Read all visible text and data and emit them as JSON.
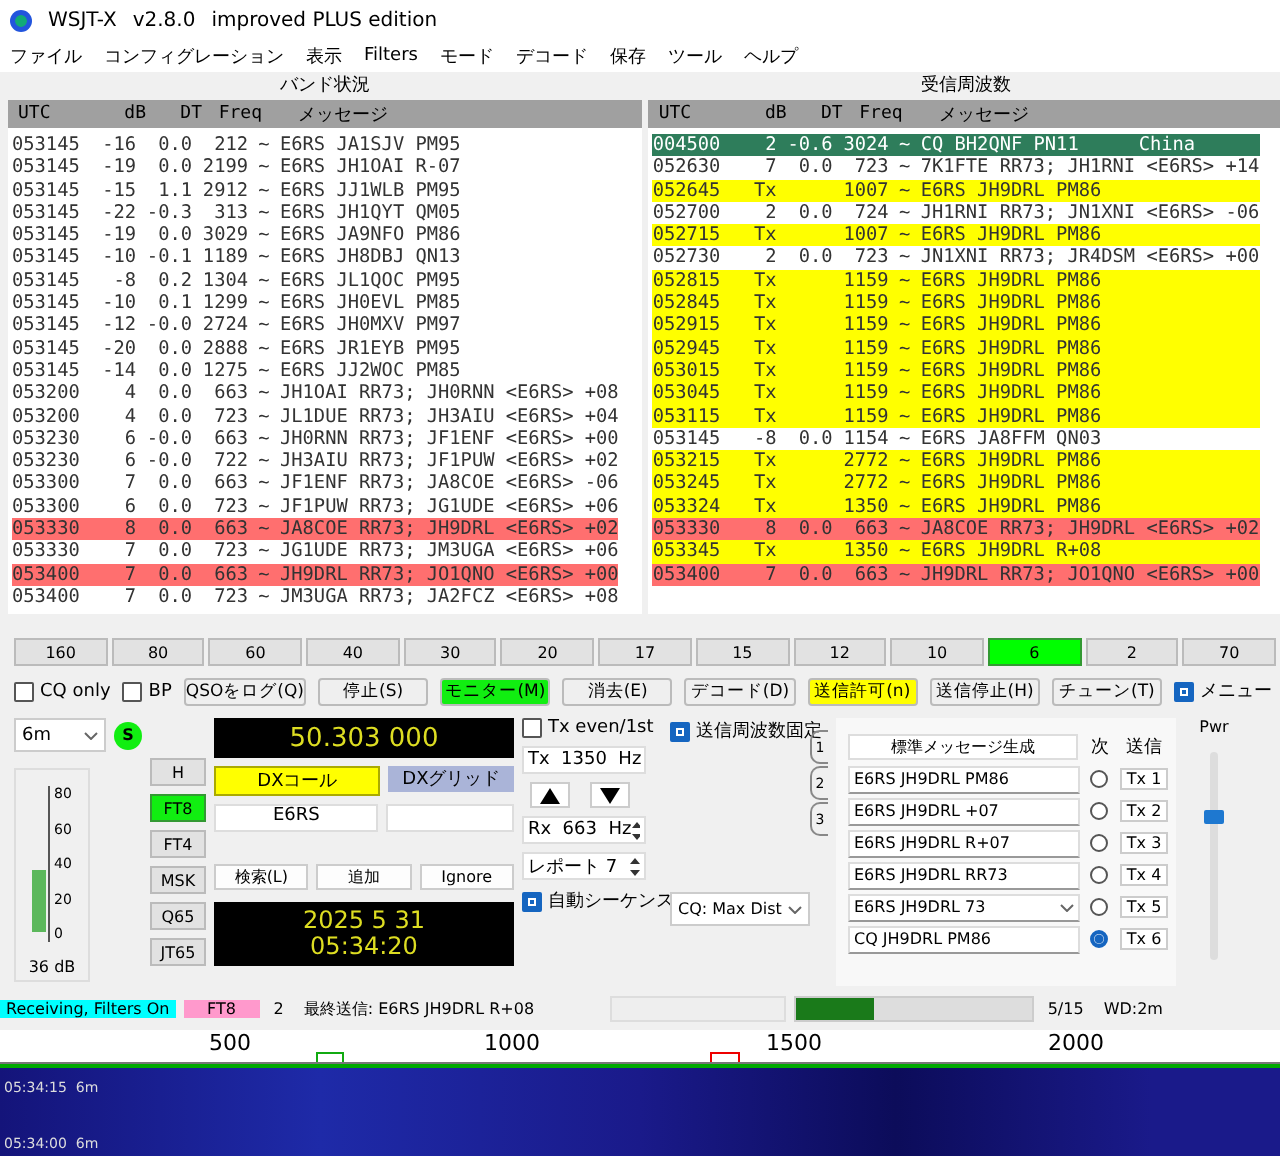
{
  "window": {
    "title": "WSJT-X",
    "version": "v2.8.0",
    "edition": "improved PLUS edition"
  },
  "menu": [
    "ファイル",
    "コンフィグレーション",
    "表示",
    "Filters",
    "モード",
    "デコード",
    "保存",
    "ツール",
    "ヘルプ"
  ],
  "band_activity": {
    "title": "バンド状況",
    "columns": [
      "UTC",
      "dB",
      "DT",
      "Freq",
      "メッセージ"
    ],
    "rows": [
      {
        "kind": "normal",
        "utc": "053145",
        "db": "-16",
        "dt": "0.0",
        "freq": "212",
        "sep": "~",
        "message": "E6RS JA1SJV PM95"
      },
      {
        "kind": "normal",
        "utc": "053145",
        "db": "-19",
        "dt": "0.0",
        "freq": "2199",
        "sep": "~",
        "message": "E6RS JH1OAI R-07"
      },
      {
        "kind": "normal",
        "utc": "053145",
        "db": "-15",
        "dt": "1.1",
        "freq": "2912",
        "sep": "~",
        "message": "E6RS JJ1WLB PM95"
      },
      {
        "kind": "normal",
        "utc": "053145",
        "db": "-22",
        "dt": "-0.3",
        "freq": "313",
        "sep": "~",
        "message": "E6RS JH1QYT QM05"
      },
      {
        "kind": "normal",
        "utc": "053145",
        "db": "-19",
        "dt": "0.0",
        "freq": "3029",
        "sep": "~",
        "message": "E6RS JA9NFO PM86"
      },
      {
        "kind": "normal",
        "utc": "053145",
        "db": "-10",
        "dt": "-0.1",
        "freq": "1189",
        "sep": "~",
        "message": "E6RS JH8DBJ QN13"
      },
      {
        "kind": "normal",
        "utc": "053145",
        "db": "-8",
        "dt": "0.2",
        "freq": "1304",
        "sep": "~",
        "message": "E6RS JL1QOC PM95"
      },
      {
        "kind": "normal",
        "utc": "053145",
        "db": "-10",
        "dt": "0.1",
        "freq": "1299",
        "sep": "~",
        "message": "E6RS JH0EVL PM85"
      },
      {
        "kind": "normal",
        "utc": "053145",
        "db": "-12",
        "dt": "-0.0",
        "freq": "2724",
        "sep": "~",
        "message": "E6RS JH0MXV PM97"
      },
      {
        "kind": "normal",
        "utc": "053145",
        "db": "-20",
        "dt": "0.0",
        "freq": "2888",
        "sep": "~",
        "message": "E6RS JR1EYB PM95"
      },
      {
        "kind": "normal",
        "utc": "053145",
        "db": "-14",
        "dt": "0.0",
        "freq": "1275",
        "sep": "~",
        "message": "E6RS JJ2WOC PM85"
      },
      {
        "kind": "normal",
        "utc": "053200",
        "db": "4",
        "dt": "0.0",
        "freq": "663",
        "sep": "~",
        "message": "JH1OAI RR73; JH0RNN <E6RS> +08"
      },
      {
        "kind": "normal",
        "utc": "053200",
        "db": "4",
        "dt": "0.0",
        "freq": "723",
        "sep": "~",
        "message": "JL1DUE RR73; JH3AIU <E6RS> +04"
      },
      {
        "kind": "normal",
        "utc": "053230",
        "db": "6",
        "dt": "-0.0",
        "freq": "663",
        "sep": "~",
        "message": "JH0RNN RR73; JF1ENF <E6RS> +00"
      },
      {
        "kind": "normal",
        "utc": "053230",
        "db": "6",
        "dt": "-0.0",
        "freq": "722",
        "sep": "~",
        "message": "JH3AIU RR73; JF1PUW <E6RS> +02"
      },
      {
        "kind": "normal",
        "utc": "053300",
        "db": "7",
        "dt": "0.0",
        "freq": "663",
        "sep": "~",
        "message": "JF1ENF RR73; JA8COE <E6RS> -06"
      },
      {
        "kind": "normal",
        "utc": "053300",
        "db": "6",
        "dt": "0.0",
        "freq": "723",
        "sep": "~",
        "message": "JF1PUW RR73; JG1UDE <E6RS> +06"
      },
      {
        "kind": "mine",
        "utc": "053330",
        "db": "8",
        "dt": "0.0",
        "freq": "663",
        "sep": "~",
        "message": "JA8COE RR73; JH9DRL <E6RS> +02"
      },
      {
        "kind": "normal",
        "utc": "053330",
        "db": "7",
        "dt": "0.0",
        "freq": "723",
        "sep": "~",
        "message": "JG1UDE RR73; JM3UGA <E6RS> +06"
      },
      {
        "kind": "mine",
        "utc": "053400",
        "db": "7",
        "dt": "0.0",
        "freq": "663",
        "sep": "~",
        "message": "JH9DRL RR73; JO1QNO <E6RS> +00"
      },
      {
        "kind": "normal",
        "utc": "053400",
        "db": "7",
        "dt": "0.0",
        "freq": "723",
        "sep": "~",
        "message": "JM3UGA RR73; JA2FCZ <E6RS> +08"
      }
    ]
  },
  "rx_frequency": {
    "title": "受信周波数",
    "columns": [
      "UTC",
      "dB",
      "DT",
      "Freq",
      "メッセージ"
    ],
    "rows": [
      {
        "kind": "cq",
        "utc": "004500",
        "db": "2",
        "dt": "-0.6",
        "freq": "3024",
        "sep": "~",
        "message": "CQ BH2QNF PN11",
        "country": "China"
      },
      {
        "kind": "normal",
        "utc": "052630",
        "db": "7",
        "dt": "0.0",
        "freq": "723",
        "sep": "~",
        "message": "7K1FTE RR73; JH1RNI <E6RS> +14"
      },
      {
        "kind": "tx",
        "utc": "052645",
        "db": "Tx",
        "freq": "1007",
        "sep": "~",
        "message": "E6RS JH9DRL PM86"
      },
      {
        "kind": "normal",
        "utc": "052700",
        "db": "2",
        "dt": "0.0",
        "freq": "724",
        "sep": "~",
        "message": "JH1RNI RR73; JN1XNI <E6RS> -06"
      },
      {
        "kind": "tx",
        "utc": "052715",
        "db": "Tx",
        "freq": "1007",
        "sep": "~",
        "message": "E6RS JH9DRL PM86"
      },
      {
        "kind": "normal",
        "utc": "052730",
        "db": "2",
        "dt": "0.0",
        "freq": "723",
        "sep": "~",
        "message": "JN1XNI RR73; JR4DSM <E6RS> +00"
      },
      {
        "kind": "tx",
        "utc": "052815",
        "db": "Tx",
        "freq": "1159",
        "sep": "~",
        "message": "E6RS JH9DRL PM86"
      },
      {
        "kind": "tx",
        "utc": "052845",
        "db": "Tx",
        "freq": "1159",
        "sep": "~",
        "message": "E6RS JH9DRL PM86"
      },
      {
        "kind": "tx",
        "utc": "052915",
        "db": "Tx",
        "freq": "1159",
        "sep": "~",
        "message": "E6RS JH9DRL PM86"
      },
      {
        "kind": "tx",
        "utc": "052945",
        "db": "Tx",
        "freq": "1159",
        "sep": "~",
        "message": "E6RS JH9DRL PM86"
      },
      {
        "kind": "tx",
        "utc": "053015",
        "db": "Tx",
        "freq": "1159",
        "sep": "~",
        "message": "E6RS JH9DRL PM86"
      },
      {
        "kind": "tx",
        "utc": "053045",
        "db": "Tx",
        "freq": "1159",
        "sep": "~",
        "message": "E6RS JH9DRL PM86"
      },
      {
        "kind": "tx",
        "utc": "053115",
        "db": "Tx",
        "freq": "1159",
        "sep": "~",
        "message": "E6RS JH9DRL PM86"
      },
      {
        "kind": "normal",
        "utc": "053145",
        "db": "-8",
        "dt": "0.0",
        "freq": "1154",
        "sep": "~",
        "message": "E6RS JA8FFM QN03"
      },
      {
        "kind": "tx",
        "utc": "053215",
        "db": "Tx",
        "freq": "2772",
        "sep": "~",
        "message": "E6RS JH9DRL PM86"
      },
      {
        "kind": "tx",
        "utc": "053245",
        "db": "Tx",
        "freq": "2772",
        "sep": "~",
        "message": "E6RS JH9DRL PM86"
      },
      {
        "kind": "tx",
        "utc": "053324",
        "db": "Tx",
        "freq": "1350",
        "sep": "~",
        "message": "E6RS JH9DRL PM86"
      },
      {
        "kind": "mine",
        "utc": "053330",
        "db": "8",
        "dt": "0.0",
        "freq": "663",
        "sep": "~",
        "message": "JA8COE RR73; JH9DRL <E6RS> +02"
      },
      {
        "kind": "tx",
        "utc": "053345",
        "db": "Tx",
        "freq": "1350",
        "sep": "~",
        "message": "E6RS JH9DRL R+08"
      },
      {
        "kind": "mine",
        "utc": "053400",
        "db": "7",
        "dt": "0.0",
        "freq": "663",
        "sep": "~",
        "message": "JH9DRL RR73; JO1QNO <E6RS> +00"
      }
    ]
  },
  "bands": [
    {
      "label": "160",
      "selected": false
    },
    {
      "label": "80",
      "selected": false
    },
    {
      "label": "60",
      "selected": false
    },
    {
      "label": "40",
      "selected": false
    },
    {
      "label": "30",
      "selected": false
    },
    {
      "label": "20",
      "selected": false
    },
    {
      "label": "17",
      "selected": false
    },
    {
      "label": "15",
      "selected": false
    },
    {
      "label": "12",
      "selected": false
    },
    {
      "label": "10",
      "selected": false
    },
    {
      "label": "6",
      "selected": true
    },
    {
      "label": "2",
      "selected": false
    },
    {
      "label": "70",
      "selected": false
    }
  ],
  "cq_only": {
    "label": "CQ only",
    "checked": false
  },
  "bp": {
    "label": "BP",
    "checked": false
  },
  "buttons": [
    {
      "label": "QSOをログ(Q)"
    },
    {
      "label": "停止(S)"
    },
    {
      "label": "モニター(M)",
      "color": "#11ee11"
    },
    {
      "label": "消去(E)"
    },
    {
      "label": "デコード(D)"
    },
    {
      "label": "送信許可(n)",
      "color": "#ffff00"
    },
    {
      "label": "送信停止(H)"
    },
    {
      "label": "チューン(T)"
    }
  ],
  "menu_toggle": {
    "label": "メニュー",
    "checked": true
  },
  "band_select": "6m",
  "s_indicator": "S",
  "dial_frequency": "50.303 000",
  "meter": {
    "ticks": [
      "80",
      "60",
      "40",
      "20",
      "0"
    ],
    "level": 0.45,
    "reading": "36 dB"
  },
  "modes": [
    {
      "label": "H",
      "selected": false
    },
    {
      "label": "FT8",
      "selected": true
    },
    {
      "label": "FT4",
      "selected": false
    },
    {
      "label": "MSK",
      "selected": false
    },
    {
      "label": "Q65",
      "selected": false
    },
    {
      "label": "JT65",
      "selected": false
    }
  ],
  "dx_call": {
    "label": "DXコール",
    "value": "E6RS"
  },
  "dx_grid": {
    "label": "DXグリッド"
  },
  "lookup_buttons": [
    "検索(L)",
    "追加",
    "Ignore"
  ],
  "date": "2025 5 31",
  "time": "05:34:20",
  "tx_even": {
    "label": "Tx even/1st",
    "checked": false
  },
  "tx_freq": "Tx  1350  Hz",
  "rx_freq": "Rx  663  Hz",
  "report": "レポート 7",
  "auto_seq": {
    "label": "自動シーケンス",
    "checked": true
  },
  "hold_tx_freq": {
    "label": "送信周波数固定",
    "checked": true
  },
  "cq_filter": "CQ: Max Dist",
  "msg_tabs": [
    "1",
    "2",
    "3"
  ],
  "messages": {
    "generate": "標準メッセージ生成",
    "next_header": "次",
    "send_header": "送信",
    "rows": [
      {
        "kind": "field",
        "text": "E6RS JH9DRL PM86",
        "button": "Tx 1",
        "selected": false
      },
      {
        "kind": "field",
        "text": "E6RS JH9DRL +07",
        "button": "Tx 2",
        "selected": false
      },
      {
        "kind": "field",
        "text": "E6RS JH9DRL R+07",
        "button": "Tx 3",
        "selected": false
      },
      {
        "kind": "field",
        "text": "E6RS JH9DRL RR73",
        "button": "Tx 4",
        "selected": false
      },
      {
        "kind": "combo",
        "text": "E6RS JH9DRL 73",
        "button": "Tx 5",
        "selected": false
      },
      {
        "kind": "field",
        "text": "CQ JH9DRL PM86",
        "button": "Tx 6",
        "selected": true
      }
    ]
  },
  "power": {
    "label": "Pwr",
    "level": 0.68
  },
  "status": {
    "state": "Receiving, Filters On",
    "mode": "FT8",
    "count": "2",
    "last_tx": "最終送信: E6RS JH9DRL R+08",
    "progress": {
      "level": 0.33
    },
    "period": "5/15",
    "wd": "WD:2m"
  },
  "waterfall": {
    "scale": [
      "500",
      "1000",
      "1500",
      "2000"
    ],
    "timestamps": [
      "05:34:15  6m",
      "05:34:00  6m"
    ]
  }
}
